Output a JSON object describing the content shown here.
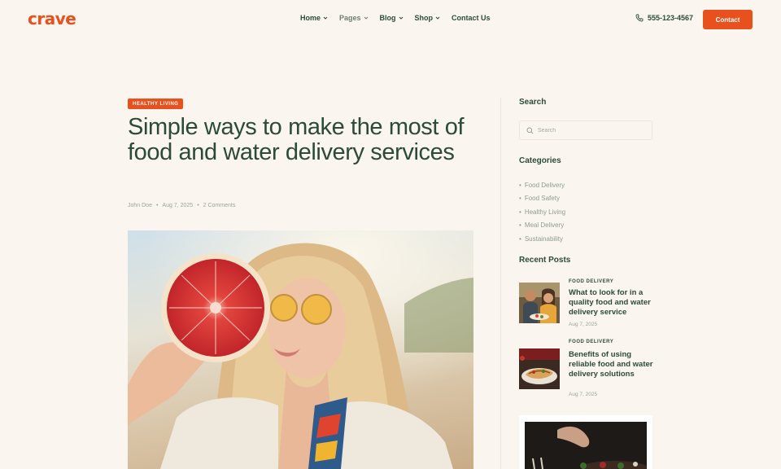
{
  "header": {
    "logo": "crave",
    "nav": [
      {
        "label": "Home"
      },
      {
        "label": "Pages"
      },
      {
        "label": "Blog"
      },
      {
        "label": "Shop"
      },
      {
        "label": "Contact Us"
      }
    ],
    "phone": "555-123-4567",
    "contact_label": "Contact"
  },
  "article": {
    "badge": "HEALTHY LIVING",
    "title": "Simple ways to make the most of food and water delivery services",
    "author": "John Doe",
    "date": "Aug 7, 2025",
    "comments": "2 Comments",
    "meta_sep": "•"
  },
  "sidebar": {
    "search_heading": "Search",
    "search_placeholder": "Search",
    "categories_heading": "Categories",
    "categories": [
      "Food Delivery",
      "Food Safety",
      "Healthy Living",
      "Meal Delivery",
      "Sustainability"
    ],
    "recent_heading": "Recent Posts",
    "recent_posts": [
      {
        "category": "FOOD DELIVERY",
        "title": "What to look for in a quality food and water delivery service",
        "date": "Aug 7, 2025"
      },
      {
        "category": "FOOD DELIVERY",
        "title": "Benefits of using reliable food and water delivery solutions",
        "date": "Aug 7, 2025"
      }
    ]
  },
  "colors": {
    "accent": "#e8501d",
    "text": "#2b4a3a",
    "background": "#faf6ef"
  }
}
